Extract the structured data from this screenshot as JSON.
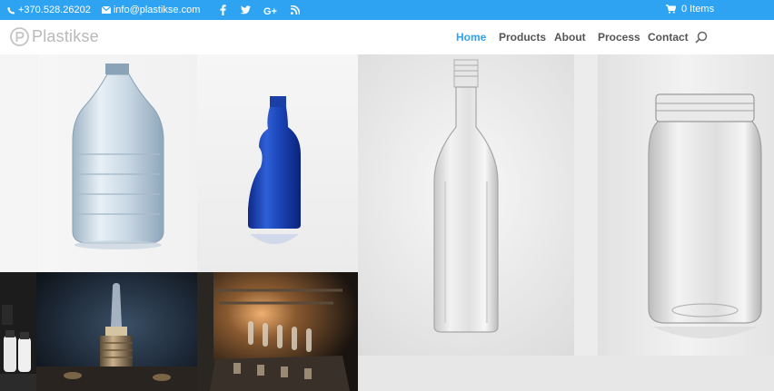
{
  "topbar": {
    "phone": "+370.528.26202",
    "email": "info@plastikse.com",
    "social_icons": [
      "facebook-icon",
      "twitter-icon",
      "google-plus-icon",
      "rss-icon"
    ],
    "cart_label": "0 Items",
    "background": "#2ea3f2"
  },
  "header": {
    "logo_text": "Plastikse",
    "nav": [
      {
        "label": "Home",
        "active": true
      },
      {
        "label": "Products",
        "active": false
      },
      {
        "label": "About",
        "active": false
      },
      {
        "label": "Process",
        "active": false
      },
      {
        "label": "Contact",
        "active": false
      }
    ],
    "accent": "#2ea3f2"
  },
  "gallery": {
    "tiles": [
      {
        "name": "clear-large-bottle-image",
        "subject": "clear PET water bottle"
      },
      {
        "name": "blue-spray-bottle-image",
        "subject": "blue PET bottle"
      },
      {
        "name": "clear-tall-bottle-image",
        "subject": "tall clear glass-style bottle"
      },
      {
        "name": "clear-jar-image",
        "subject": "clear plastic jar"
      },
      {
        "name": "small-bottles-image",
        "subject": "small bottles"
      },
      {
        "name": "preform-machine-image",
        "subject": "preform on machine"
      },
      {
        "name": "factory-line-image",
        "subject": "production line"
      }
    ]
  }
}
